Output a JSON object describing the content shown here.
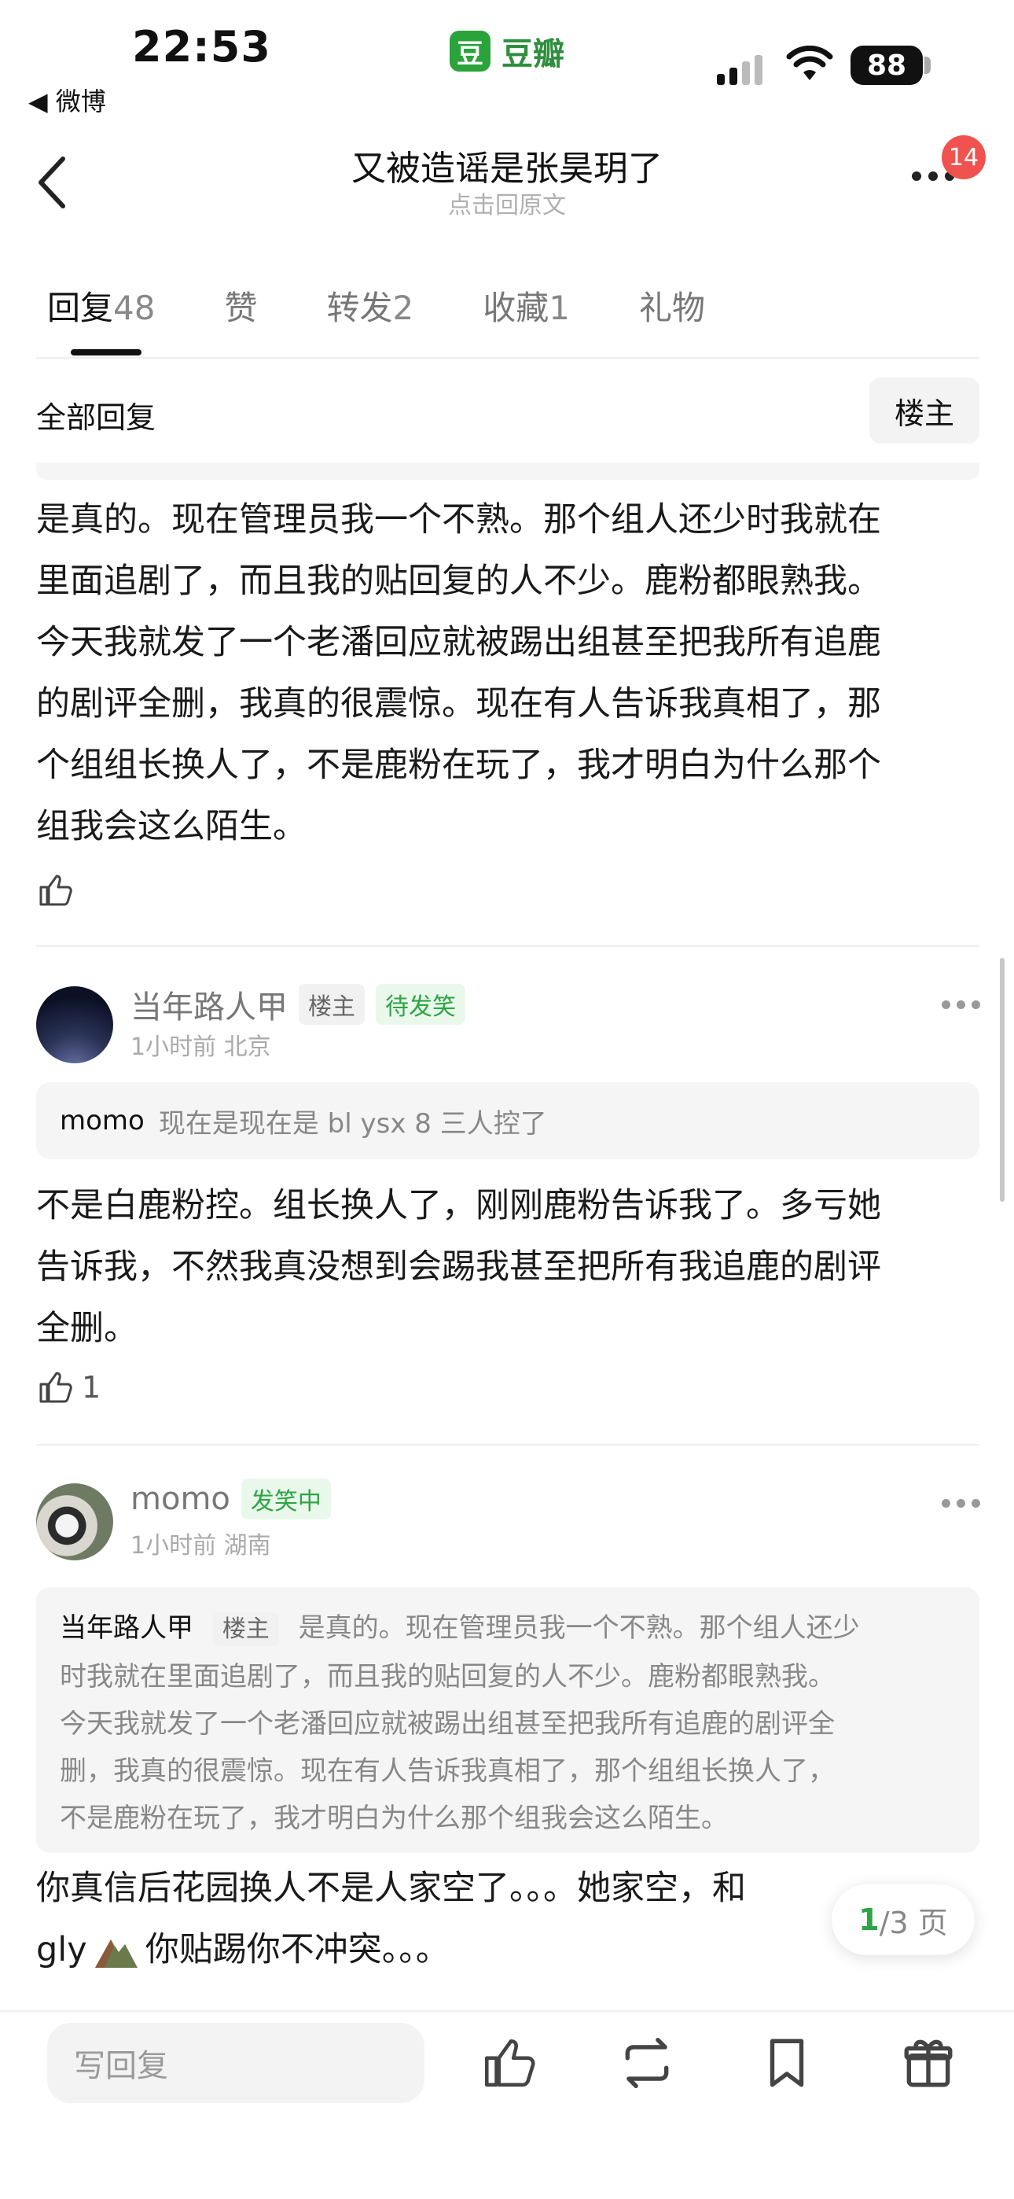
{
  "status_bar": {
    "time": "22:53",
    "back_app": "◀ 微博",
    "app_name": "豆瓣",
    "app_logo_char": "豆",
    "battery": "88"
  },
  "nav": {
    "title": "又被造谣是张昊玥了",
    "subtitle": "点击回原文",
    "notification_count": "14"
  },
  "tabs": [
    {
      "label": "回复",
      "count": "48"
    },
    {
      "label": "赞",
      "count": ""
    },
    {
      "label": "转发",
      "count": "2"
    },
    {
      "label": "收藏",
      "count": "1"
    },
    {
      "label": "礼物",
      "count": ""
    }
  ],
  "filter": {
    "all_replies": "全部回复",
    "op_only": "楼主"
  },
  "comments": [
    {
      "text_lines": [
        "是真的。现在管理员我一个不熟。那个组人还少时我就在",
        "里面追剧了，而且我的贴回复的人不少。鹿粉都眼熟我。",
        "今天我就发了一个老潘回应就被踢出组甚至把我所有追鹿",
        "的剧评全删，我真的很震惊。现在有人告诉我真相了，那",
        "个组组长换人了，不是鹿粉在玩了，我才明白为什么那个",
        "组我会这么陌生。"
      ],
      "likes": ""
    },
    {
      "username": "当年路人甲",
      "tag_op": "楼主",
      "tag_status": "待发笑",
      "time": "1小时前",
      "location": "北京",
      "quote_name": "momo",
      "quote_text": "现在是现在是 bl ysx 8 三人控了",
      "text_lines": [
        "不是白鹿粉控。组长换人了，刚刚鹿粉告诉我了。多亏她",
        "告诉我，不然我真没想到会踢我甚至把所有我追鹿的剧评",
        "全删。"
      ],
      "likes": "1"
    },
    {
      "username": "momo",
      "tag_status": "发笑中",
      "time": "1小时前",
      "location": "湖南",
      "quote_name": "当年路人甲",
      "quote_tag": "楼主",
      "quote_lines": [
        "是真的。现在管理员我一个不熟。那个组人还少",
        "时我就在里面追剧了，而且我的贴回复的人不少。鹿粉都眼熟我。",
        "今天我就发了一个老潘回应就被踢出组甚至把我所有追鹿的剧评全",
        "删，我真的很震惊。现在有人告诉我真相了，那个组组长换人了，",
        "不是鹿粉在玩了，我才明白为什么那个组我会这么陌生。"
      ],
      "text_line1": "你真信后花园换人不是人家空了。。。她家空，和",
      "text_line2_a": "gly",
      "text_line2_b": "你贴踢你不冲突。。。"
    }
  ],
  "pager": {
    "current": "1",
    "total": "/3 页"
  },
  "bottom": {
    "reply_placeholder": "写回复"
  }
}
